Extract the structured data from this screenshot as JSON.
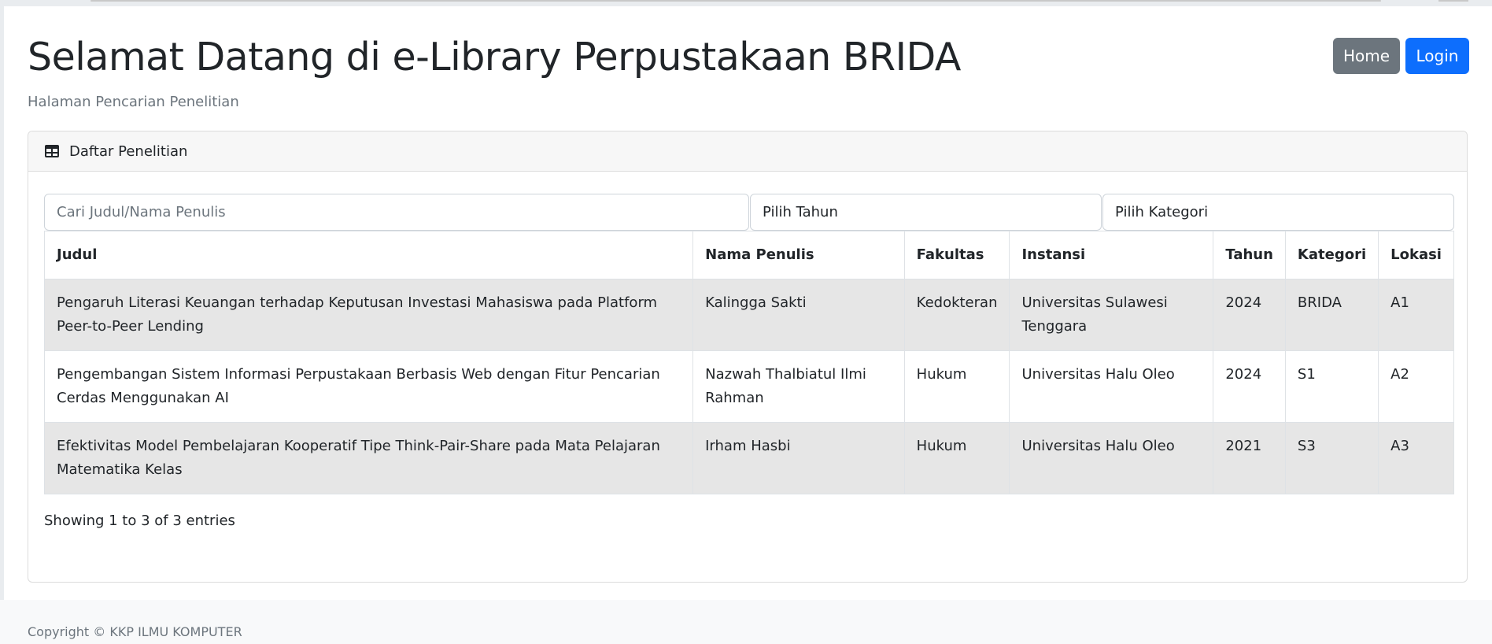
{
  "header": {
    "title": "Selamat Datang di e-Library Perpustakaan BRIDA",
    "subtitle": "Halaman Pencarian Penelitian",
    "home_label": "Home",
    "login_label": "Login"
  },
  "card": {
    "title": "Daftar Penelitian",
    "icon": "table-icon"
  },
  "filters": {
    "search_placeholder": "Cari Judul/Nama Penulis",
    "year_label": "Pilih Tahun",
    "category_label": "Pilih Kategori"
  },
  "table": {
    "headers": [
      "Judul",
      "Nama Penulis",
      "Fakultas",
      "Instansi",
      "Tahun",
      "Kategori",
      "Lokasi"
    ],
    "rows": [
      [
        "Pengaruh Literasi Keuangan terhadap Keputusan Investasi Mahasiswa pada Platform Peer-to-Peer Lending",
        "Kalingga Sakti",
        "Kedokteran",
        "Universitas Sulawesi Tenggara",
        "2024",
        "BRIDA",
        "A1"
      ],
      [
        "Pengembangan Sistem Informasi Perpustakaan Berbasis Web dengan Fitur Pencarian Cerdas Menggunakan AI",
        "Nazwah Thalbiatul Ilmi Rahman",
        "Hukum",
        "Universitas Halu Oleo",
        "2024",
        "S1",
        "A2"
      ],
      [
        "Efektivitas Model Pembelajaran Kooperatif Tipe Think-Pair-Share pada Mata Pelajaran Matematika Kelas",
        "Irham Hasbi",
        "Hukum",
        "Universitas Halu Oleo",
        "2021",
        "S3",
        "A3"
      ]
    ],
    "info": "Showing 1 to 3 of 3 entries"
  },
  "footer": {
    "copyright": "Copyright © KKP ILMU KOMPUTER"
  },
  "colors": {
    "primary": "#0d6efd",
    "secondary": "#6c757d",
    "striped_row": "#e6e6e6"
  }
}
